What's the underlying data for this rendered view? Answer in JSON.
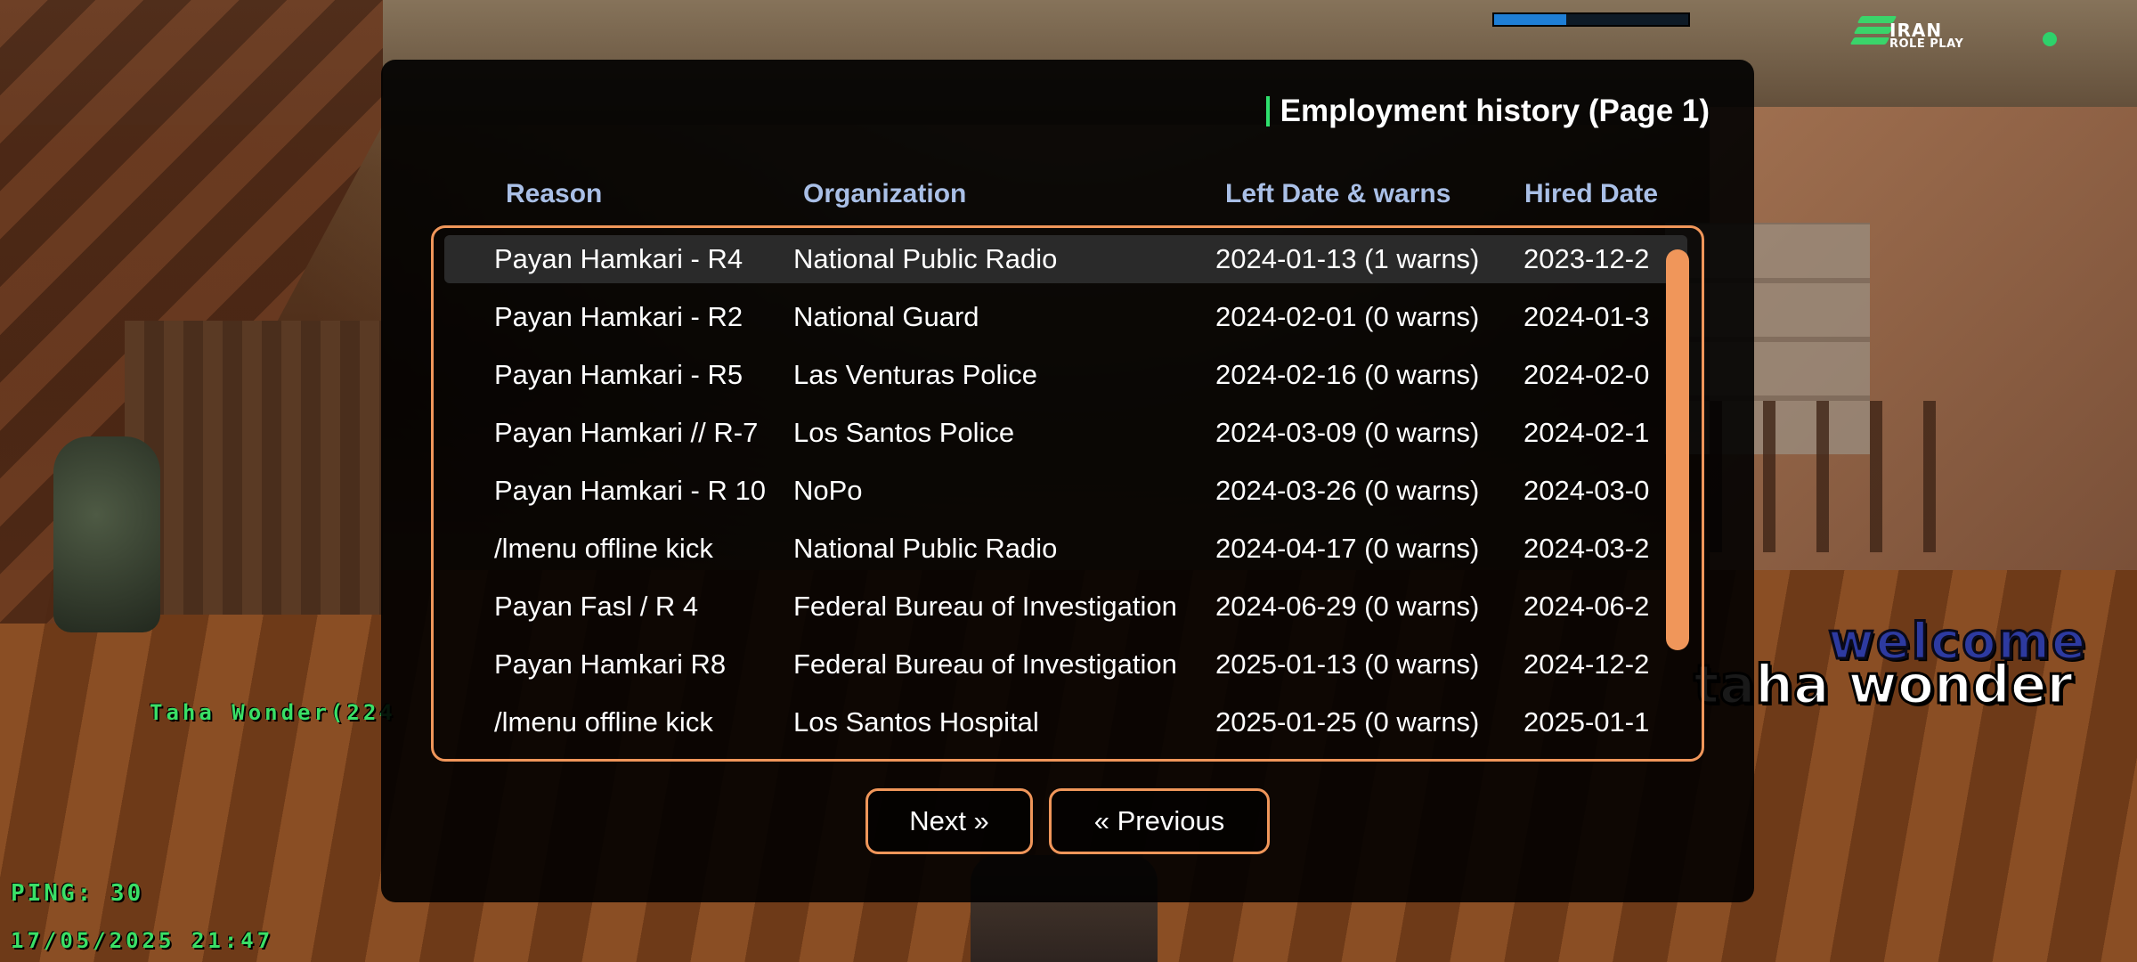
{
  "hud": {
    "progress": 0.37,
    "logo_line1": "IRAN",
    "logo_line2": "ROLE PLAY",
    "player_tag": "Taha Wonder(224",
    "ping": "PING: 30",
    "datetime": "17/05/2025 21:47",
    "welcome": "welcome",
    "welcome_name": "taha wonder",
    "colors": {
      "hud_green": "#3adf66",
      "status_dot": "#2ed16b",
      "welcome_blue": "#2d3aa0"
    }
  },
  "dialog": {
    "title": "Employment history (Page 1)",
    "columns": [
      "Reason",
      "Organization",
      "Left Date & warns",
      "Hired Date"
    ],
    "selected_row": 0,
    "rows": [
      {
        "reason": "Payan Hamkari - R4",
        "organization": "National Public Radio",
        "left": "2024-01-13 (1 warns)",
        "hired": "2023-12-2"
      },
      {
        "reason": "Payan Hamkari - R2",
        "organization": "National Guard",
        "left": "2024-02-01 (0 warns)",
        "hired": "2024-01-3"
      },
      {
        "reason": "Payan Hamkari - R5",
        "organization": "Las Venturas Police",
        "left": "2024-02-16 (0 warns)",
        "hired": "2024-02-0"
      },
      {
        "reason": "Payan Hamkari // R-7",
        "organization": "Los Santos Police",
        "left": "2024-03-09 (0 warns)",
        "hired": "2024-02-1"
      },
      {
        "reason": "Payan Hamkari - R 10",
        "organization": "NoPo",
        "left": "2024-03-26 (0 warns)",
        "hired": "2024-03-0"
      },
      {
        "reason": "/lmenu offline kick",
        "organization": "National Public Radio",
        "left": "2024-04-17 (0 warns)",
        "hired": "2024-03-2"
      },
      {
        "reason": "Payan Fasl / R 4",
        "organization": "Federal Bureau of Investigation",
        "left": "2024-06-29 (0 warns)",
        "hired": "2024-06-2"
      },
      {
        "reason": "Payan Hamkari R8",
        "organization": "Federal Bureau of Investigation",
        "left": "2025-01-13 (0 warns)",
        "hired": "2024-12-2"
      },
      {
        "reason": "/lmenu offline kick",
        "organization": "Los Santos Hospital",
        "left": "2025-01-25 (0 warns)",
        "hired": "2025-01-1"
      }
    ],
    "buttons": {
      "next": "Next »",
      "previous": "« Previous"
    },
    "colors": {
      "accent_border": "#f0965a",
      "title_accent": "#2ee06d",
      "header_text": "#a9bfe6"
    }
  }
}
